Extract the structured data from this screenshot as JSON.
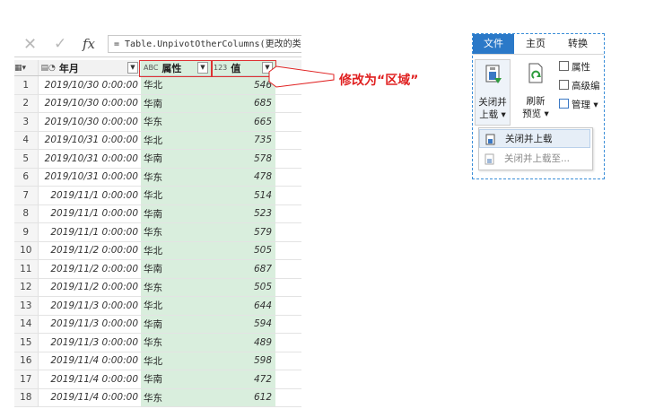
{
  "formula_bar": {
    "cancel_glyph": "✕",
    "confirm_glyph": "✓",
    "fx_label": "fx",
    "formula": "= Table.UnpivotOtherColumns(更改的类型, {\"年月\"}, \"属性\", \"值\")"
  },
  "grid": {
    "headers": {
      "date": {
        "icon": "calendar-clock-icon",
        "type_glyph": "📅",
        "label": "年月"
      },
      "attr": {
        "icon": "text-type-icon",
        "type_glyph": "ABC",
        "label": "属性"
      },
      "value": {
        "icon": "number-type-icon",
        "type_glyph": "123",
        "label": "值"
      }
    },
    "rows": [
      {
        "n": "1",
        "date": "2019/10/30 0:00:00",
        "attr": "华北",
        "value": "546"
      },
      {
        "n": "2",
        "date": "2019/10/30 0:00:00",
        "attr": "华南",
        "value": "685"
      },
      {
        "n": "3",
        "date": "2019/10/30 0:00:00",
        "attr": "华东",
        "value": "665"
      },
      {
        "n": "4",
        "date": "2019/10/31 0:00:00",
        "attr": "华北",
        "value": "735"
      },
      {
        "n": "5",
        "date": "2019/10/31 0:00:00",
        "attr": "华南",
        "value": "578"
      },
      {
        "n": "6",
        "date": "2019/10/31 0:00:00",
        "attr": "华东",
        "value": "478"
      },
      {
        "n": "7",
        "date": "2019/11/1 0:00:00",
        "attr": "华北",
        "value": "514"
      },
      {
        "n": "8",
        "date": "2019/11/1 0:00:00",
        "attr": "华南",
        "value": "523"
      },
      {
        "n": "9",
        "date": "2019/11/1 0:00:00",
        "attr": "华东",
        "value": "579"
      },
      {
        "n": "10",
        "date": "2019/11/2 0:00:00",
        "attr": "华北",
        "value": "505"
      },
      {
        "n": "11",
        "date": "2019/11/2 0:00:00",
        "attr": "华南",
        "value": "687"
      },
      {
        "n": "12",
        "date": "2019/11/2 0:00:00",
        "attr": "华东",
        "value": "505"
      },
      {
        "n": "13",
        "date": "2019/11/3 0:00:00",
        "attr": "华北",
        "value": "644"
      },
      {
        "n": "14",
        "date": "2019/11/3 0:00:00",
        "attr": "华南",
        "value": "594"
      },
      {
        "n": "15",
        "date": "2019/11/3 0:00:00",
        "attr": "华东",
        "value": "489"
      },
      {
        "n": "16",
        "date": "2019/11/4 0:00:00",
        "attr": "华北",
        "value": "598"
      },
      {
        "n": "17",
        "date": "2019/11/4 0:00:00",
        "attr": "华南",
        "value": "472"
      },
      {
        "n": "18",
        "date": "2019/11/4 0:00:00",
        "attr": "华东",
        "value": "612"
      }
    ]
  },
  "annotation": {
    "text": "修改为“区域”",
    "color": "#e02020"
  },
  "ribbon": {
    "tabs": {
      "file": "文件",
      "home": "主页",
      "transform": "转换"
    },
    "close_load": {
      "line1": "关闭并",
      "line2": "上载 ▾"
    },
    "refresh": {
      "line1": "刷新",
      "line2": "预览 ▾"
    },
    "properties": "属性",
    "advanced_editor": "高级编",
    "manage": "管理 ▾",
    "menu": {
      "close_load": "关闭并上载",
      "close_load_to": "关闭并上载至..."
    },
    "file_tab_color": "#2b79c8"
  }
}
